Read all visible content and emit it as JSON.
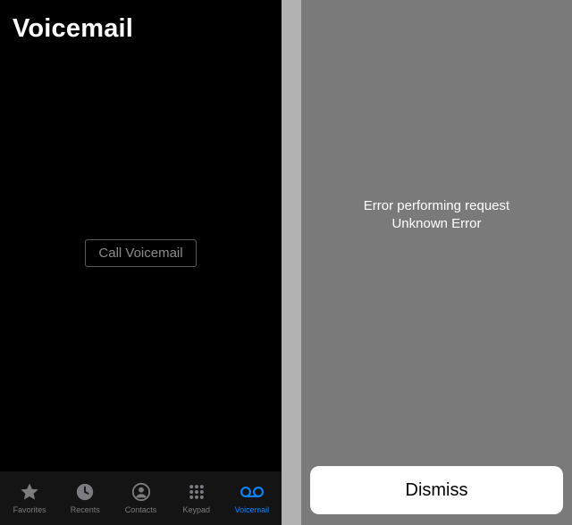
{
  "header": {
    "title": "Voicemail"
  },
  "callButton": {
    "label": "Call Voicemail"
  },
  "tabs": [
    {
      "label": "Favorites",
      "icon": "star-icon"
    },
    {
      "label": "Recents",
      "icon": "clock-icon"
    },
    {
      "label": "Contacts",
      "icon": "contact-icon"
    },
    {
      "label": "Keypad",
      "icon": "keypad-icon"
    },
    {
      "label": "Voicemail",
      "icon": "voicemail-icon",
      "active": true
    }
  ],
  "error": {
    "line1": "Error performing request",
    "line2": "Unknown Error"
  },
  "dismiss": {
    "label": "Dismiss"
  }
}
